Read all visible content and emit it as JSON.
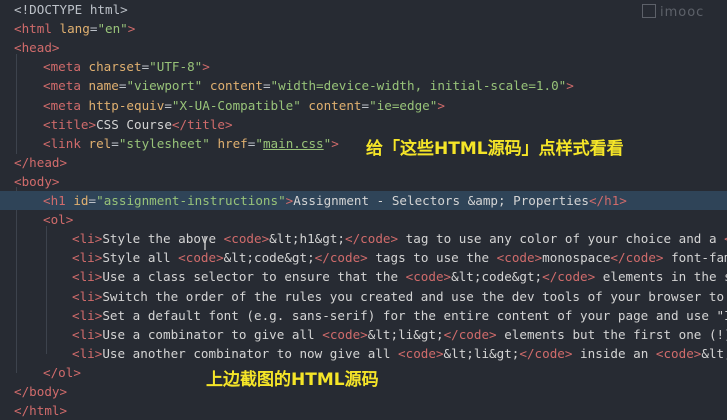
{
  "editor": {
    "lines": [
      {
        "indent": 0,
        "tokens": [
          [
            "d",
            "<!DOCTYPE html>"
          ]
        ]
      },
      {
        "indent": 0,
        "tokens": [
          [
            "t",
            "<html "
          ],
          [
            "a",
            "lang"
          ],
          [
            "d",
            "="
          ],
          [
            "s",
            "\"en\""
          ],
          [
            "t",
            ">"
          ]
        ]
      },
      {
        "indent": 0,
        "tokens": [
          [
            "t",
            "<head>"
          ]
        ]
      },
      {
        "indent": 1,
        "tokens": [
          [
            "t",
            "<meta "
          ],
          [
            "a",
            "charset"
          ],
          [
            "d",
            "="
          ],
          [
            "s",
            "\"UTF-8\""
          ],
          [
            "t",
            ">"
          ]
        ]
      },
      {
        "indent": 1,
        "tokens": [
          [
            "t",
            "<meta "
          ],
          [
            "a",
            "name"
          ],
          [
            "d",
            "="
          ],
          [
            "s",
            "\"viewport\""
          ],
          [
            "d",
            " "
          ],
          [
            "a",
            "content"
          ],
          [
            "d",
            "="
          ],
          [
            "s",
            "\"width=device-width, initial-scale=1.0\""
          ],
          [
            "t",
            ">"
          ]
        ]
      },
      {
        "indent": 1,
        "tokens": [
          [
            "t",
            "<meta "
          ],
          [
            "a",
            "http-equiv"
          ],
          [
            "d",
            "="
          ],
          [
            "s",
            "\"X-UA-Compatible\""
          ],
          [
            "d",
            " "
          ],
          [
            "a",
            "content"
          ],
          [
            "d",
            "="
          ],
          [
            "s",
            "\"ie=edge\""
          ],
          [
            "t",
            ">"
          ]
        ]
      },
      {
        "indent": 1,
        "tokens": [
          [
            "t",
            "<title>"
          ],
          [
            "tx",
            "CSS Course"
          ],
          [
            "t",
            "</title>"
          ]
        ]
      },
      {
        "indent": 1,
        "tokens": [
          [
            "t",
            "<link "
          ],
          [
            "a",
            "rel"
          ],
          [
            "d",
            "="
          ],
          [
            "s",
            "\"stylesheet\""
          ],
          [
            "d",
            " "
          ],
          [
            "a",
            "href"
          ],
          [
            "d",
            "="
          ],
          [
            "s",
            "\""
          ],
          [
            "su",
            "main.css"
          ],
          [
            "s",
            "\""
          ],
          [
            "t",
            ">"
          ]
        ]
      },
      {
        "indent": 0,
        "tokens": [
          [
            "t",
            "</head>"
          ]
        ]
      },
      {
        "indent": 0,
        "tokens": [
          [
            "t",
            "<body>"
          ]
        ]
      },
      {
        "indent": 1,
        "hl": true,
        "tokens": [
          [
            "t",
            "<h1 "
          ],
          [
            "a",
            "id"
          ],
          [
            "d",
            "="
          ],
          [
            "s",
            "\"assignment-instructions\""
          ],
          [
            "t",
            ">"
          ],
          [
            "tx",
            "Assignment - Selectors &amp; Properties"
          ],
          [
            "t",
            "</h1>"
          ]
        ]
      },
      {
        "indent": 1,
        "tokens": [
          [
            "t",
            "<ol>"
          ]
        ]
      },
      {
        "indent": 2,
        "tokens": [
          [
            "t",
            "<li>"
          ],
          [
            "tx",
            "Style the above "
          ],
          [
            "t",
            "<code>"
          ],
          [
            "tx",
            "&lt;h1&gt;"
          ],
          [
            "t",
            "</code>"
          ],
          [
            "tx",
            " tag to use any color of your choice and a "
          ],
          [
            "t",
            "<c"
          ]
        ]
      },
      {
        "indent": 2,
        "tokens": [
          [
            "t",
            "<li>"
          ],
          [
            "tx",
            "Style all "
          ],
          [
            "t",
            "<code>"
          ],
          [
            "tx",
            "&lt;code&gt;"
          ],
          [
            "t",
            "</code>"
          ],
          [
            "tx",
            " tags to use the "
          ],
          [
            "t",
            "<code>"
          ],
          [
            "tx",
            "monospace"
          ],
          [
            "t",
            "</code>"
          ],
          [
            "tx",
            " font-fami"
          ]
        ]
      },
      {
        "indent": 2,
        "tokens": [
          [
            "t",
            "<li>"
          ],
          [
            "tx",
            "Use a class selector to ensure that the "
          ],
          [
            "t",
            "<code>"
          ],
          [
            "tx",
            "&lt;code&gt;"
          ],
          [
            "t",
            "</code>"
          ],
          [
            "tx",
            " elements in the se"
          ]
        ]
      },
      {
        "indent": 2,
        "tokens": [
          [
            "t",
            "<li>"
          ],
          [
            "tx",
            "Switch the order of the rules you created and use the dev tools of your browser to u"
          ]
        ]
      },
      {
        "indent": 2,
        "tokens": [
          [
            "t",
            "<li>"
          ],
          [
            "tx",
            "Set a default font (e.g. sans-serif) for the entire content of your page and use \"In"
          ]
        ]
      },
      {
        "indent": 2,
        "tokens": [
          [
            "t",
            "<li>"
          ],
          [
            "tx",
            "Use a combinator to give all "
          ],
          [
            "t",
            "<code>"
          ],
          [
            "tx",
            "&lt;li&gt;"
          ],
          [
            "t",
            "</code>"
          ],
          [
            "tx",
            " elements but the first one (!) "
          ]
        ]
      },
      {
        "indent": 2,
        "tokens": [
          [
            "t",
            "<li>"
          ],
          [
            "tx",
            "Use another combinator to now give all "
          ],
          [
            "t",
            "<code>"
          ],
          [
            "tx",
            "&lt;li&gt;"
          ],
          [
            "t",
            "</code>"
          ],
          [
            "tx",
            " inside an "
          ],
          [
            "t",
            "<code>"
          ],
          [
            "tx",
            "&lt;o"
          ]
        ]
      },
      {
        "indent": 1,
        "tokens": [
          [
            "t",
            "</ol>"
          ]
        ]
      },
      {
        "indent": 0,
        "tokens": [
          [
            "t",
            "</body>"
          ]
        ]
      },
      {
        "indent": 0,
        "tokens": [
          [
            "t",
            "</html>"
          ]
        ]
      }
    ]
  },
  "captions": {
    "top": "给「这些HTML源码」点样式看看",
    "bottom": "上边截图的HTML源码"
  },
  "watermark": {
    "text": "imooc"
  },
  "colors": {
    "background": "#272b33",
    "tag": "#d06b6b",
    "attribute": "#e0b070",
    "string": "#98c379",
    "text": "#d4d4d4",
    "highlight_line": "#2f4458",
    "caption": "#f5e528"
  }
}
